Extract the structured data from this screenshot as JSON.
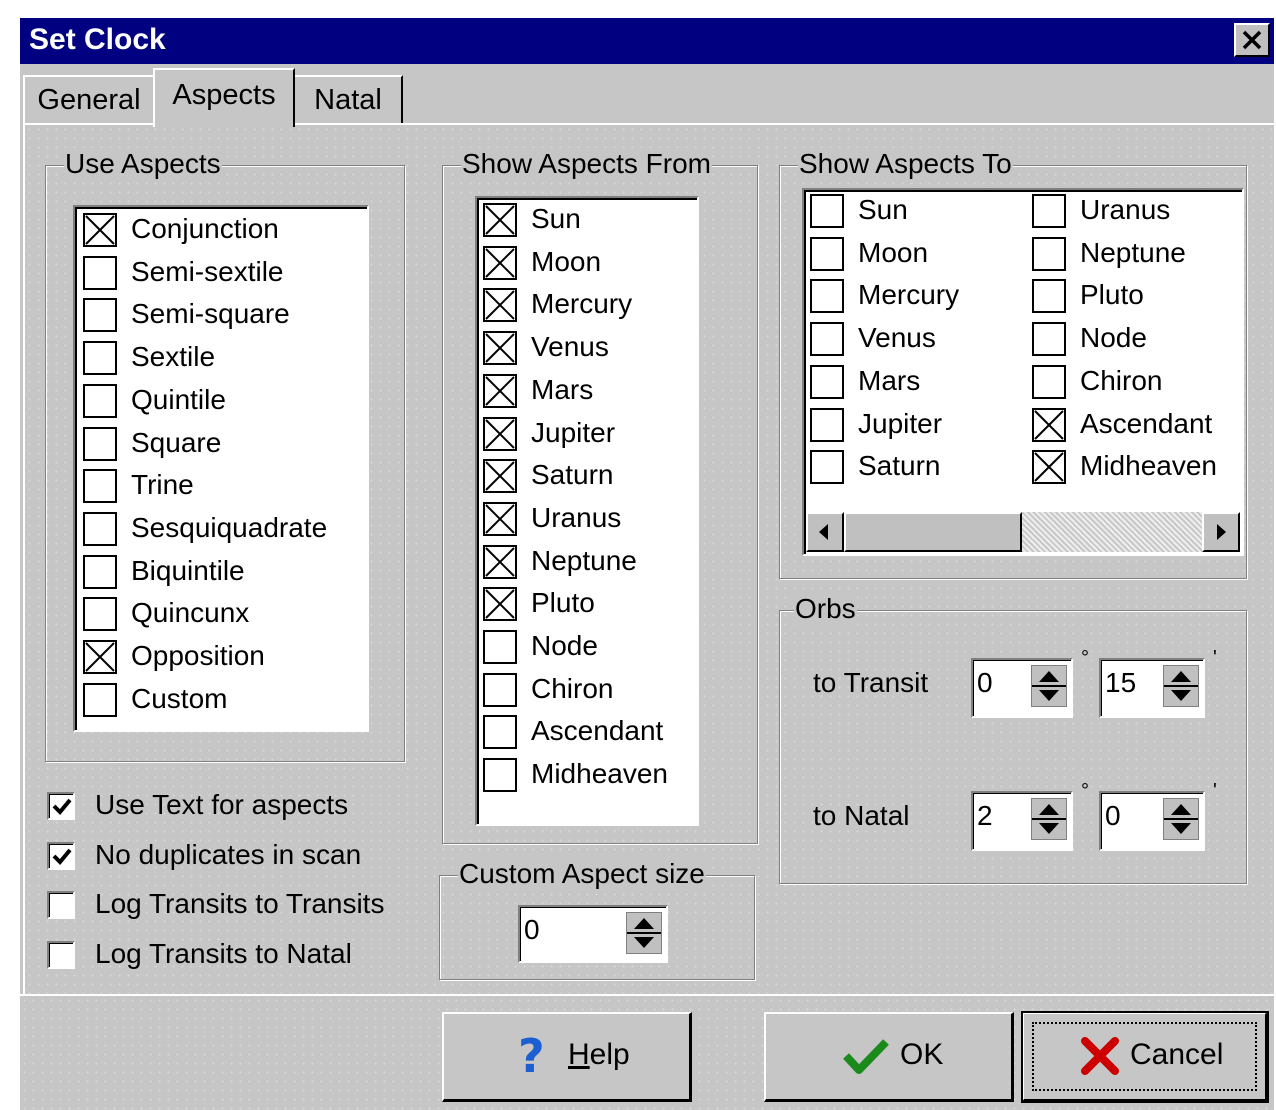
{
  "window": {
    "title": "Set Clock"
  },
  "tabs": [
    {
      "label": "General",
      "active": false
    },
    {
      "label": "Aspects",
      "active": true
    },
    {
      "label": "Natal",
      "active": false
    }
  ],
  "use_aspects": {
    "legend": "Use Aspects",
    "items": [
      {
        "label": "Conjunction",
        "checked": true
      },
      {
        "label": "Semi-sextile",
        "checked": false
      },
      {
        "label": "Semi-square",
        "checked": false
      },
      {
        "label": "Sextile",
        "checked": false
      },
      {
        "label": "Quintile",
        "checked": false
      },
      {
        "label": "Square",
        "checked": false
      },
      {
        "label": "Trine",
        "checked": false
      },
      {
        "label": "Sesquiquadrate",
        "checked": false
      },
      {
        "label": "Biquintile",
        "checked": false
      },
      {
        "label": "Quincunx",
        "checked": false
      },
      {
        "label": "Opposition",
        "checked": true
      },
      {
        "label": "Custom",
        "checked": false
      }
    ]
  },
  "options": [
    {
      "label": "Use Text for aspects",
      "checked": true
    },
    {
      "label": "No duplicates in scan",
      "checked": true
    },
    {
      "label": "Log Transits to Transits",
      "checked": false
    },
    {
      "label": "Log Transits to Natal",
      "checked": false
    }
  ],
  "show_from": {
    "legend": "Show Aspects From",
    "items": [
      {
        "label": "Sun",
        "checked": true
      },
      {
        "label": "Moon",
        "checked": true
      },
      {
        "label": "Mercury",
        "checked": true
      },
      {
        "label": "Venus",
        "checked": true
      },
      {
        "label": "Mars",
        "checked": true
      },
      {
        "label": "Jupiter",
        "checked": true
      },
      {
        "label": "Saturn",
        "checked": true
      },
      {
        "label": "Uranus",
        "checked": true
      },
      {
        "label": "Neptune",
        "checked": true
      },
      {
        "label": "Pluto",
        "checked": true
      },
      {
        "label": "Node",
        "checked": false
      },
      {
        "label": "Chiron",
        "checked": false
      },
      {
        "label": "Ascendant",
        "checked": false
      },
      {
        "label": "Midheaven",
        "checked": false
      }
    ]
  },
  "custom_size": {
    "legend": "Custom Aspect size",
    "value": "0"
  },
  "show_to": {
    "legend": "Show Aspects To",
    "col1": [
      {
        "label": "Sun",
        "checked": false
      },
      {
        "label": "Moon",
        "checked": false
      },
      {
        "label": "Mercury",
        "checked": false
      },
      {
        "label": "Venus",
        "checked": false
      },
      {
        "label": "Mars",
        "checked": false
      },
      {
        "label": "Jupiter",
        "checked": false
      },
      {
        "label": "Saturn",
        "checked": false
      }
    ],
    "col2": [
      {
        "label": "Uranus",
        "checked": false
      },
      {
        "label": "Neptune",
        "checked": false
      },
      {
        "label": "Pluto",
        "checked": false
      },
      {
        "label": "Node",
        "checked": false
      },
      {
        "label": "Chiron",
        "checked": false
      },
      {
        "label": "Ascendant",
        "checked": true
      },
      {
        "label": "Midheaven",
        "checked": true
      }
    ]
  },
  "orbs": {
    "legend": "Orbs",
    "transit": {
      "label": "to Transit",
      "degrees": "0",
      "minutes": "15"
    },
    "natal": {
      "label": "to Natal",
      "degrees": "2",
      "minutes": "0"
    },
    "degree_symbol": "°",
    "minute_symbol": "'"
  },
  "buttons": {
    "help": {
      "prefix": "",
      "accel": "H",
      "rest": "elp",
      "icon": "question-icon"
    },
    "ok": {
      "label": "OK",
      "icon": "checkmark-icon"
    },
    "cancel": {
      "label": "Cancel",
      "icon": "x-icon"
    }
  },
  "colors": {
    "title_bar": "#000080",
    "face": "#c6c6c6",
    "help_icon": "#1c5fd0",
    "ok_icon": "#1a8a1a",
    "cancel_icon": "#cc0000"
  }
}
